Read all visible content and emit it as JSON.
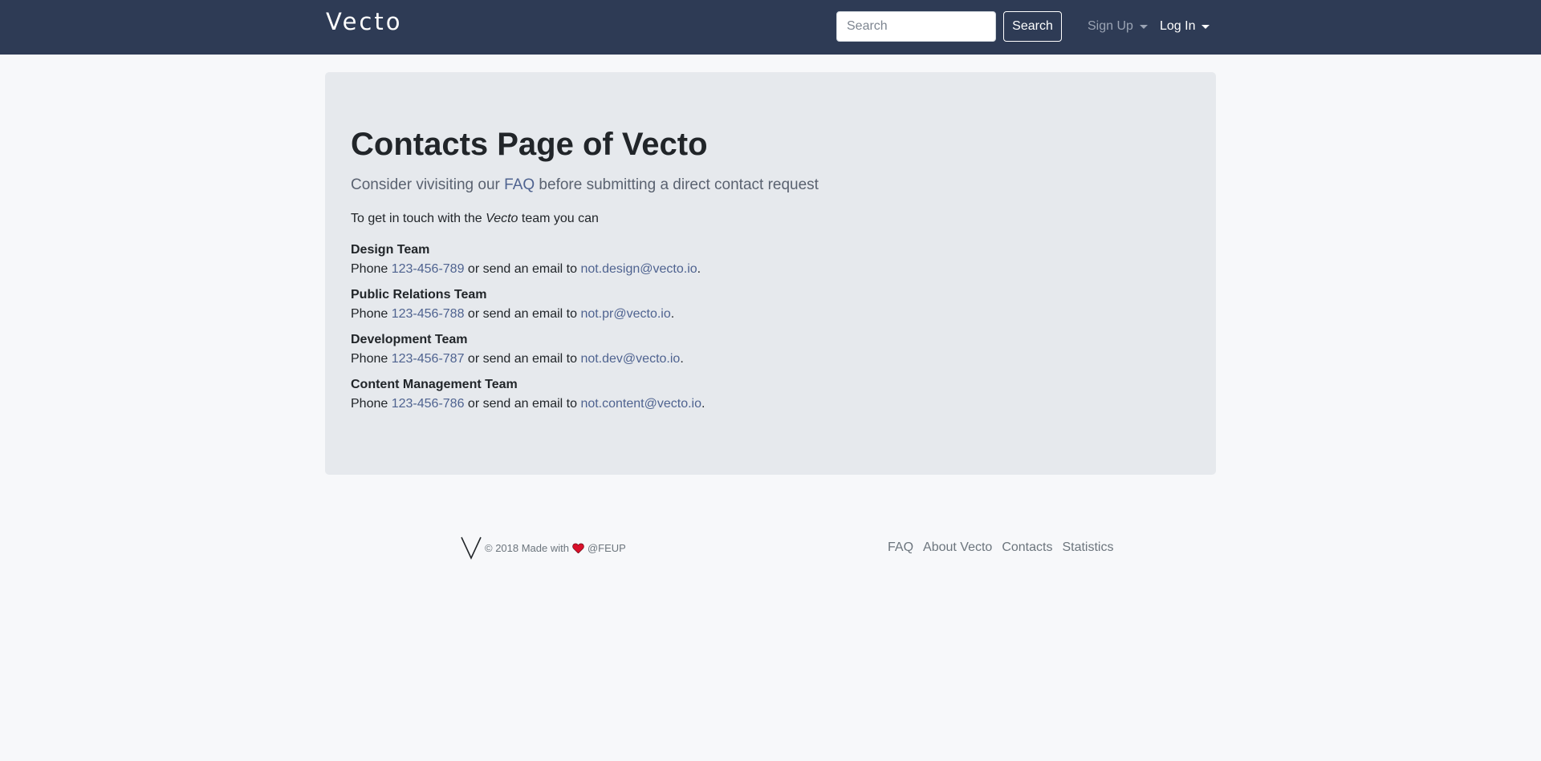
{
  "navbar": {
    "brand": "Vecto",
    "search_placeholder": "Search",
    "search_button": "Search",
    "signup_label": "Sign Up",
    "login_label": "Log In"
  },
  "main": {
    "title": "Contacts Page of Vecto",
    "lead_prefix": "Consider vivisiting our ",
    "lead_link": "FAQ",
    "lead_suffix": " before submitting a direct contact request",
    "intro_prefix": "To get in touch with the ",
    "intro_em": "Vecto",
    "intro_suffix": " team you can",
    "phone_label": "Phone ",
    "email_mid": " or send an email to ",
    "period": ".",
    "teams": [
      {
        "name": "Design Team",
        "phone": "123-456-789",
        "email": "not.design@vecto.io"
      },
      {
        "name": "Public Relations Team",
        "phone": "123-456-788",
        "email": "not.pr@vecto.io"
      },
      {
        "name": "Development Team",
        "phone": "123-456-787",
        "email": "not.dev@vecto.io"
      },
      {
        "name": "Content Management Team",
        "phone": "123-456-786",
        "email": "not.content@vecto.io"
      }
    ]
  },
  "footer": {
    "copyright_prefix": "© 2018 Made with",
    "copyright_suffix": "@FEUP",
    "heart_icon": "heart-icon",
    "logo_icon": "vecto-v-logo",
    "links": [
      "FAQ",
      "About Vecto",
      "Contacts",
      "Statistics"
    ]
  },
  "colors": {
    "navbar_bg": "#2e3b55",
    "jumbotron_bg": "#e6e9ed",
    "link": "#4f6390",
    "heart": "#d9102a"
  }
}
